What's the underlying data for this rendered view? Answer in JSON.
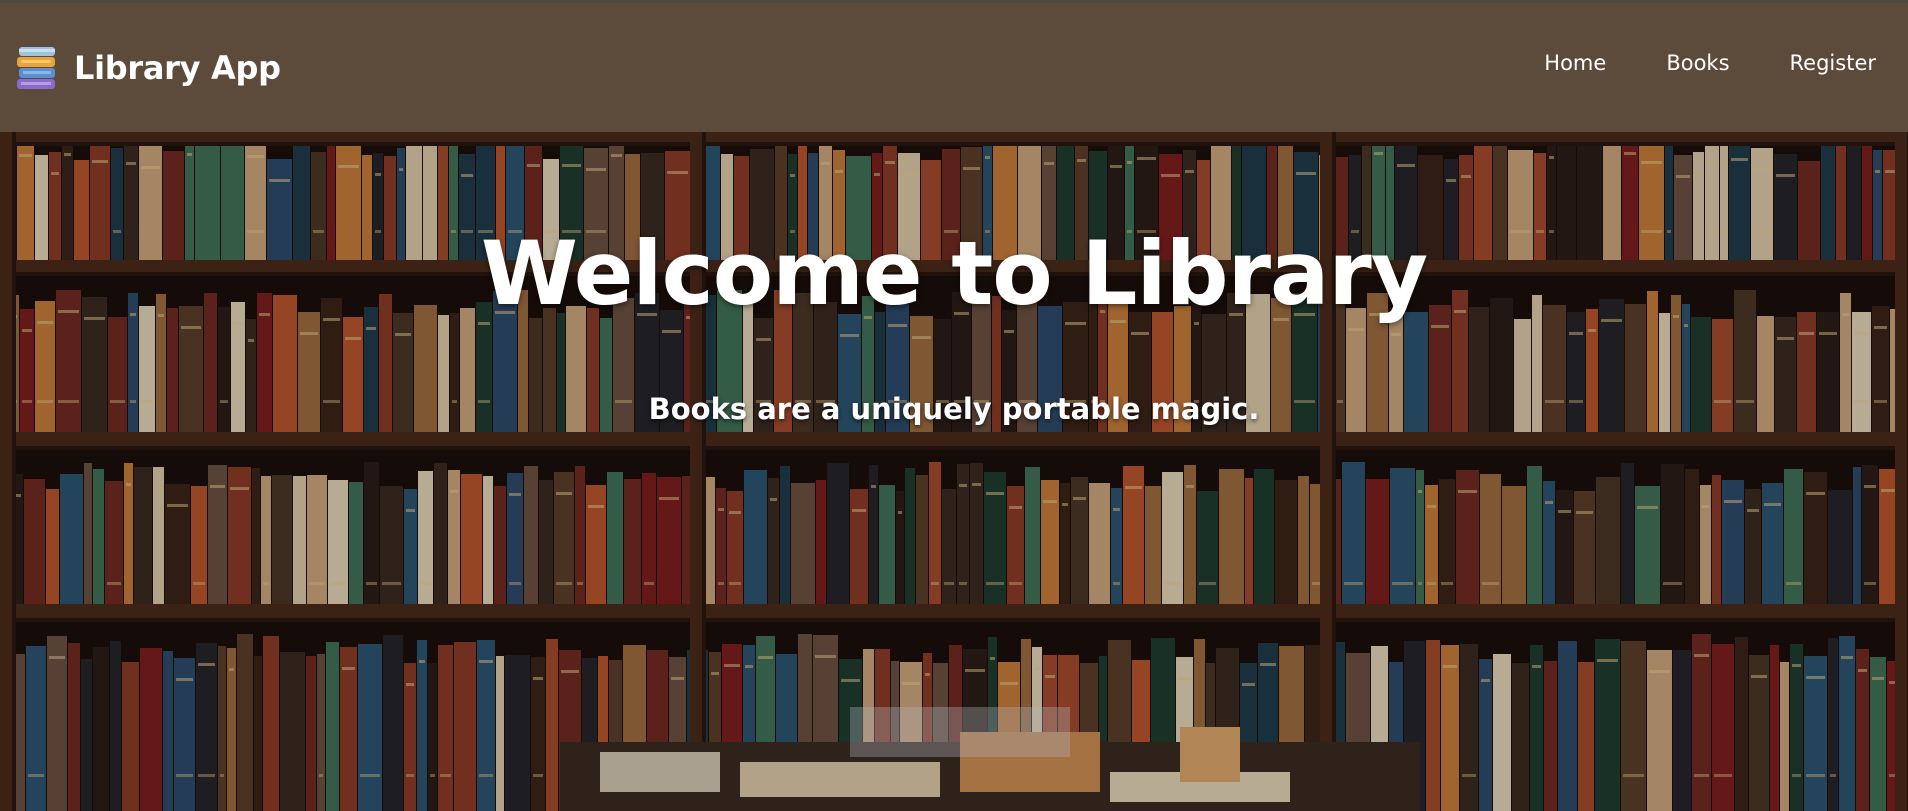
{
  "header": {
    "brand_name": "Library App",
    "brand_icon": "books-stack-icon",
    "nav": [
      {
        "label": "Home"
      },
      {
        "label": "Books"
      },
      {
        "label": "Register"
      }
    ]
  },
  "hero": {
    "title": "Welcome to Library",
    "subtitle": "Books are a uniquely portable magic.",
    "background": "bookshelf-photo"
  },
  "colors": {
    "navbar": "#5c4a3a",
    "text": "#ffffff",
    "shelf_wood": "#4a2a1a"
  }
}
